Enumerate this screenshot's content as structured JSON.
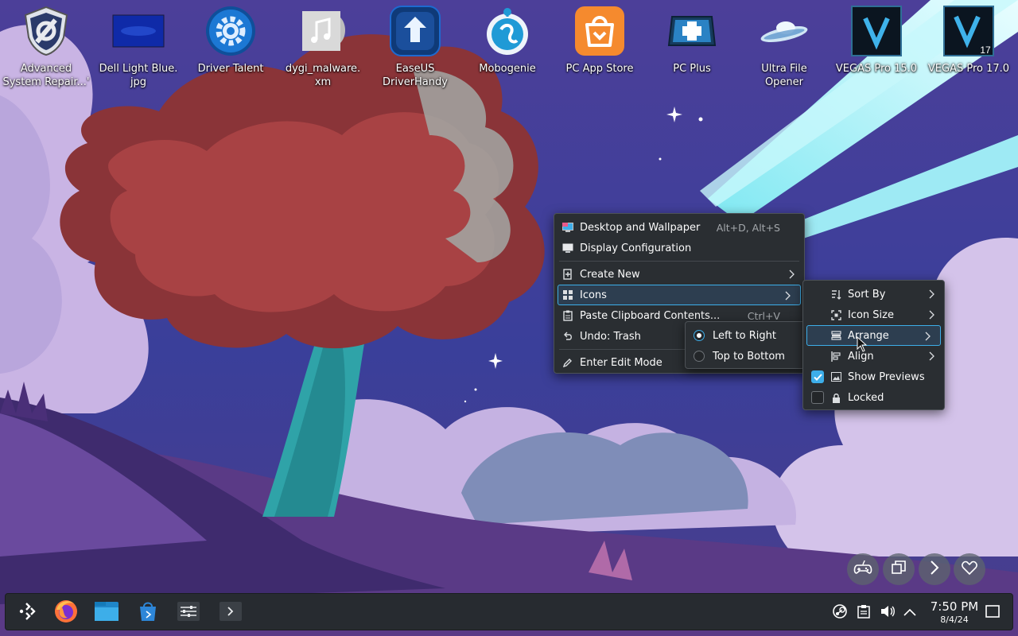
{
  "desktop_icons": [
    {
      "label": "Advanced\nSystem Repair...'",
      "icon": "shield-wrench-icon"
    },
    {
      "label": "Dell Light Blue.\njpg",
      "icon": "image-file-icon"
    },
    {
      "label": "Driver Talent",
      "icon": "gear-icon"
    },
    {
      "label": "dygi_malware.\nxm",
      "icon": "music-file-icon"
    },
    {
      "label": "EaseUS\nDriverHandy",
      "icon": "upload-icon"
    },
    {
      "label": "Mobogenie",
      "icon": "mobogenie-icon"
    },
    {
      "label": "PC App Store",
      "icon": "shopping-bag-icon"
    },
    {
      "label": "PC Plus",
      "icon": "medical-plus-icon"
    },
    {
      "label": "Ultra File\nOpener",
      "icon": "ufo-icon"
    },
    {
      "label": "VEGAS Pro 15.0",
      "icon": "vegas-icon"
    },
    {
      "label": "VEGAS Pro 17.0",
      "icon": "vegas-icon",
      "badge": "17"
    }
  ],
  "context_menu": {
    "items": [
      {
        "label": "Desktop and Wallpaper",
        "shortcut": "Alt+D, Alt+S",
        "icon": "wallpaper-icon"
      },
      {
        "label": "Display Configuration",
        "shortcut": "",
        "icon": "monitor-icon"
      },
      {
        "label": "Create New",
        "icon": "create-new-icon",
        "submenu": true
      },
      {
        "label": "Icons",
        "icon": "grid-icon",
        "submenu": true,
        "highlighted": true
      },
      {
        "label": "Paste Clipboard Contents...",
        "shortcut": "Ctrl+V",
        "icon": "clipboard-icon"
      },
      {
        "label": "Undo: Trash",
        "icon": "undo-icon"
      },
      {
        "label": "Enter Edit Mode",
        "icon": "pencil-icon"
      }
    ]
  },
  "icons_submenu": {
    "items": [
      {
        "label": "Sort By",
        "icon": "sort-icon",
        "submenu": true
      },
      {
        "label": "Icon Size",
        "icon": "resize-icon",
        "submenu": true
      },
      {
        "label": "Arrange",
        "icon": "arrange-icon",
        "submenu": true,
        "highlighted": true
      },
      {
        "label": "Align",
        "icon": "align-icon",
        "submenu": true
      },
      {
        "label": "Show Previews",
        "icon": "image-icon",
        "checked": true
      },
      {
        "label": "Locked",
        "icon": "lock-icon",
        "checked": false
      }
    ]
  },
  "arrange_submenu": {
    "items": [
      {
        "label": "Left to Right",
        "selected": true
      },
      {
        "label": "Top to Bottom",
        "selected": false
      }
    ]
  },
  "floating_buttons": [
    "gamepad-icon",
    "windows-icon",
    "chevron-right-icon",
    "heart-icon"
  ],
  "taskbar": {
    "launchers": [
      "application-launcher-icon",
      "firefox-icon",
      "file-manager-icon",
      "discover-store-icon",
      "system-settings-icon",
      "terminal-icon"
    ],
    "tray": [
      "steam-icon",
      "clipboard-icon",
      "volume-icon",
      "show-hidden-icon"
    ],
    "clock": {
      "time": "7:50 PM",
      "date": "8/4/24"
    }
  },
  "colors": {
    "accent": "#3daee9",
    "menu_bg": "#2a2e32",
    "taskbar_bg": "#272b30"
  }
}
